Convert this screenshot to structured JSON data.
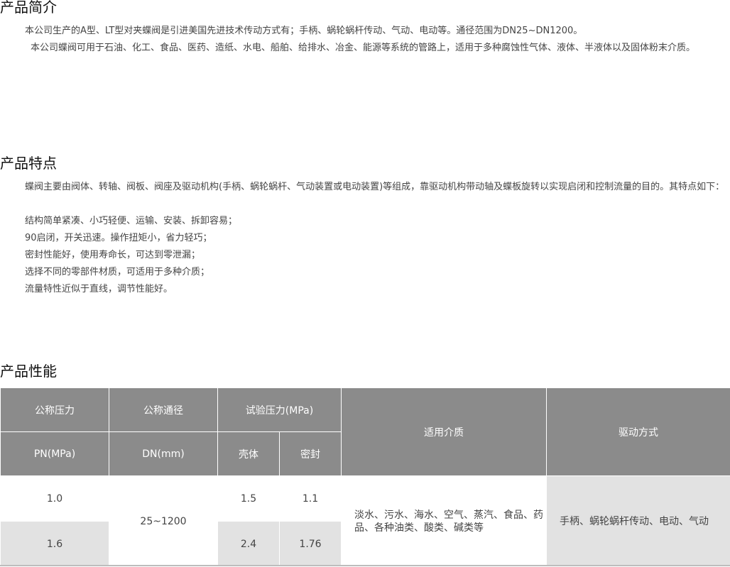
{
  "intro": {
    "title": "产品简介",
    "p1": "本公司生产的A型、LT型对夹蝶阀是引进美国先进技术传动方式有；手柄、蜗轮蜗杆传动、气动、电动等。通径范围为DN25~DN1200。",
    "p2": "本公司蝶阀可用于石油、化工、食品、医药、造纸、水电、船舶、给排水、冶金、能源等系统的管路上，适用于多种腐蚀性气体、液体、半液体以及固体粉末介质。"
  },
  "features": {
    "title": "产品特点",
    "p1": "蝶阀主要由阀体、转轴、阀板、阀座及驱动机构(手柄、蜗轮蜗杆、气动装置或电动装置)等组成，靠驱动机构带动轴及蝶板旋转以实现启闭和控制流量的目的。其特点如下：",
    "items": [
      "结构简单紧凑、小巧轻便、运输、安装、拆卸容易；",
      "90启闭，开关迅速。操作扭矩小，省力轻巧；",
      "密封性能好，使用寿命长，可达到零泄漏；",
      "选择不同的零部件材质，可适用于多种介质；",
      "流量特性近似于直线，调节性能好。"
    ]
  },
  "performance": {
    "title": "产品性能",
    "headers": {
      "nominal_pressure": "公称压力",
      "nominal_diameter": "公称通径",
      "test_pressure": "试验压力(MPa)",
      "medium": "适用介质",
      "drive": "驱动方式",
      "pn_unit": "PN(MPa)",
      "dn_unit": "DN(mm)",
      "shell": "壳体",
      "seal": "密封"
    },
    "rows": [
      {
        "pn": "1.0",
        "shell": "1.5",
        "seal": "1.1"
      },
      {
        "pn": "1.6",
        "shell": "2.4",
        "seal": "1.76"
      }
    ],
    "dn_range": "25~1200",
    "medium_value": "淡水、污水、海水、空气、蒸汽、食品、药品、各种油类、酸类、碱类等",
    "drive_value": "手柄、蜗轮蜗杆传动、电动、气动",
    "colors": {
      "header_bg": "#8b8b8b",
      "cell_gray": "#e2e2e2"
    }
  }
}
